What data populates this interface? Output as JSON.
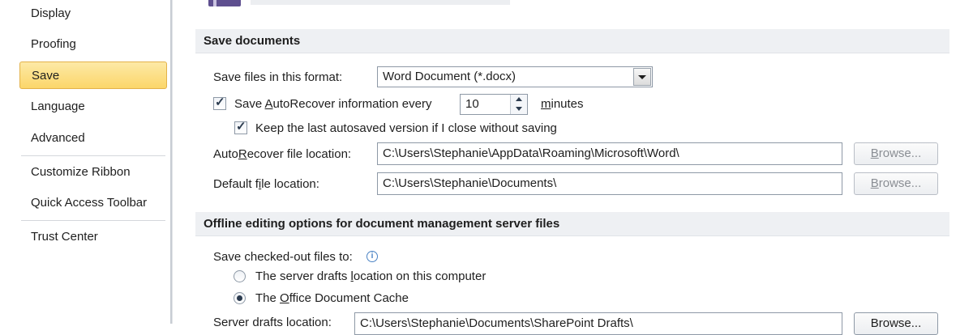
{
  "sidebar": {
    "items": [
      {
        "label": "Display"
      },
      {
        "label": "Proofing"
      },
      {
        "label": "Save"
      },
      {
        "label": "Language"
      },
      {
        "label": "Advanced"
      },
      {
        "label": "Customize Ribbon"
      },
      {
        "label": "Quick Access Toolbar"
      },
      {
        "label": "Trust Center"
      }
    ],
    "active_index": 2
  },
  "save_documents": {
    "header": "Save documents",
    "format_label": "Save files in this format:",
    "format_value": "Word Document (*.docx)",
    "autorecover_label_pre": "Save ",
    "autorecover_label_key": "A",
    "autorecover_label_post": "utoRecover information every",
    "autorecover_checked": true,
    "autorecover_minutes": "10",
    "minutes_key": "m",
    "minutes_rest": "inutes",
    "keep_last_label": "Keep the last autosaved version if I close without saving",
    "keep_last_checked": true,
    "autorecover_location_pre": "Auto",
    "autorecover_location_key": "R",
    "autorecover_location_post": "ecover file location:",
    "autorecover_location_value": "C:\\Users\\Stephanie\\AppData\\Roaming\\Microsoft\\Word\\",
    "default_location_pre": "Default f",
    "default_location_key": "i",
    "default_location_post": "le location:",
    "default_location_value": "C:\\Users\\Stephanie\\Documents\\",
    "browse_key": "B",
    "browse_rest": "rowse..."
  },
  "offline": {
    "header": "Offline editing options for document management server files",
    "save_checked_out_label": "Save checked-out files to:",
    "info_glyph": "i",
    "option1_pre": "The server drafts ",
    "option1_key": "l",
    "option1_post": "ocation on this computer",
    "option1_selected": false,
    "option2_pre": "The ",
    "option2_key": "O",
    "option2_post": "ffice Document Cache",
    "option2_selected": true,
    "server_drafts_label": "Server drafts location:",
    "server_drafts_value": "C:\\Users\\Stephanie\\Documents\\SharePoint Drafts\\",
    "browse_label": "Browse..."
  },
  "colors": {
    "active_item_bg": "#fbd66a",
    "section_header_bg": "#eef0f3"
  }
}
